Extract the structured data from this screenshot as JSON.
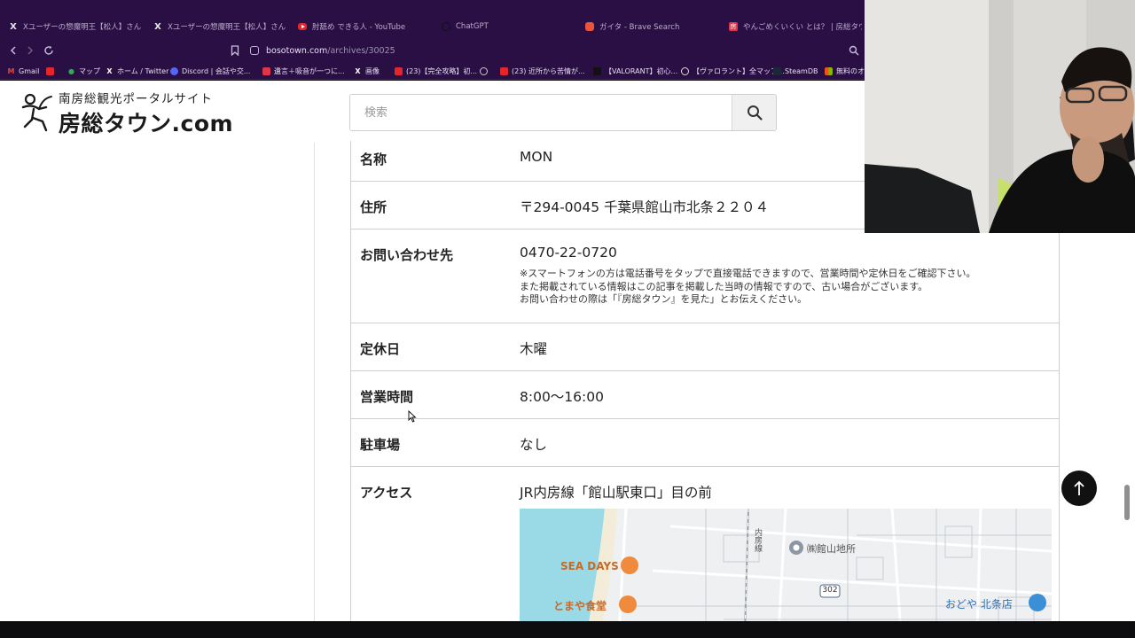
{
  "browser": {
    "tabs": [
      {
        "title": "Xユーザーの惣魔明王【松人】さん: 「https",
        "icon": "x-icon"
      },
      {
        "title": "Xユーザーの惣魔明王【松人】さん: 「https",
        "icon": "x-icon"
      },
      {
        "title": "肘舐め できる人 - YouTube",
        "icon": "youtube-icon"
      },
      {
        "title": "ChatGPT",
        "icon": "chatgpt-icon"
      },
      {
        "title": "ガイタ - Brave Search",
        "icon": "brave-icon"
      },
      {
        "title": "やんごめくいくい とは？ | 房総タウン.com",
        "icon": "bosotown-icon"
      }
    ],
    "url_domain": "bosotown.com",
    "url_path": "/archives/30025",
    "bookmarks": [
      {
        "label": "Gmail",
        "icon": "gmail-icon"
      },
      {
        "label": "",
        "icon": "youtube-icon"
      },
      {
        "label": "マップ",
        "icon": "maps-icon"
      },
      {
        "label": "ホーム / Twitter",
        "icon": "x-icon"
      },
      {
        "label": "Discord | 会話や交...",
        "icon": "discord-icon"
      },
      {
        "label": "遺言＋吸音が一つに...",
        "icon": "app-icon"
      },
      {
        "label": "画像",
        "icon": "x-icon"
      },
      {
        "label": "(23)【完全攻略】初...",
        "icon": "youtube-icon"
      },
      {
        "label": "",
        "icon": "globe-icon"
      },
      {
        "label": "(23) 近所から苦情が...",
        "icon": "youtube-icon"
      },
      {
        "label": "【VALORANT】初心...",
        "icon": "valorant-icon"
      },
      {
        "label": "【ヴァロラント】全マップ...",
        "icon": "web-icon"
      },
      {
        "label": "SteamDB",
        "icon": "steamdb-icon"
      },
      {
        "label": "無料のオ",
        "icon": "microsoft-icon"
      }
    ]
  },
  "site": {
    "tagline": "南房総観光ポータルサイト",
    "title": "房総タウン.com",
    "search_placeholder": "検索"
  },
  "info": {
    "rows": [
      {
        "label": "名称",
        "value": "MON"
      },
      {
        "label": "住所",
        "value": "〒294-0045 千葉県館山市北条２２０４"
      },
      {
        "label": "お問い合わせ先",
        "value": "0470-22-0720",
        "notes": [
          "※スマートフォンの方は電話番号をタップで直接電話できますので、営業時間や定休日をご確認下さい。",
          "また掲載されている情報はこの記事を掲載した当時の情報ですので、古い場合がございます。",
          "お問い合わせの際は「『房総タウン』を見た」とお伝えください。"
        ]
      },
      {
        "label": "定休日",
        "value": "木曜"
      },
      {
        "label": "営業時間",
        "value": "8:00〜16:00"
      },
      {
        "label": "駐車場",
        "value": "なし"
      },
      {
        "label": "アクセス",
        "value": "JR内房線「館山駅東口」目の前"
      }
    ]
  },
  "map": {
    "labels": {
      "sea_days": "SEA DAYS",
      "tomaya": "とまや食堂",
      "line": "内房線",
      "tateyama_chisho": "㈱館山地所",
      "road_number": "302",
      "odoya": "おどや 北条店"
    }
  },
  "colors": {
    "chrome_bg": "#2a0f45",
    "page_bg": "#ffffff",
    "sea": "#9ad9e6",
    "map_pin": "#f08a3c",
    "shop_pin": "#3b8fd6"
  }
}
